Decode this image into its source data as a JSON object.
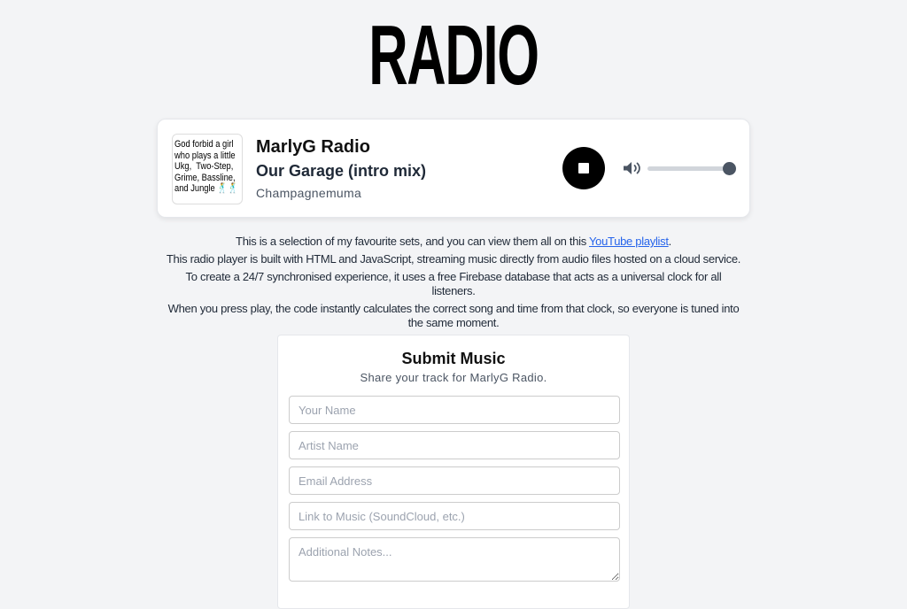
{
  "logo": {
    "text": "RADIO"
  },
  "player": {
    "cover_text": "God forbid a girl\nwho plays a little\nUkg,  Two-Step,\nGrime, Bassline,\nand Jungle 🕺🕺",
    "station": "MarlyG Radio",
    "track": "Our Garage (intro mix)",
    "artist": "Champagnemuma",
    "stop_icon": "stop-icon",
    "volume_icon": "volume-icon",
    "volume_level": 1.0
  },
  "about": {
    "line1_pre": "This is a selection of my favourite sets, and you can view them all on this ",
    "line1_link": "YouTube playlist",
    "line1_post": ".",
    "line2": "This radio player is built with HTML and JavaScript, streaming music directly from audio files hosted on a cloud service.",
    "line3": "To create a 24/7 synchronised experience, it uses a free Firebase database that acts as a universal clock for all listeners.",
    "line4": "When you press play, the code instantly calculates the correct song and time from that clock, so everyone is tuned into the same moment."
  },
  "form": {
    "title": "Submit Music",
    "subtitle": "Share your track for MarlyG Radio.",
    "name_placeholder": "Your Name",
    "artist_placeholder": "Artist Name",
    "email_placeholder": "Email Address",
    "link_placeholder": "Link to Music (SoundCloud, etc.)",
    "notes_placeholder": "Additional Notes..."
  }
}
